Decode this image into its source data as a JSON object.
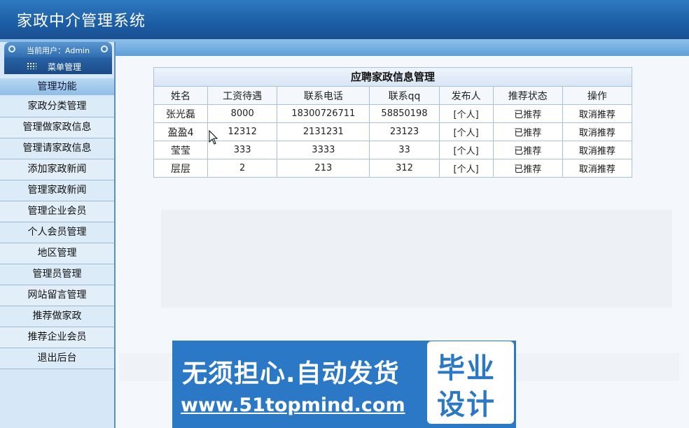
{
  "header": {
    "title": "家政中介管理系统"
  },
  "sidebar": {
    "current_user": "当前用户：Admin",
    "menu_button": "菜单管理",
    "section_title": "管理功能",
    "items": [
      {
        "label": "家政分类管理"
      },
      {
        "label": "管理做家政信息"
      },
      {
        "label": "管理请家政信息"
      },
      {
        "label": "添加家政新闻"
      },
      {
        "label": "管理家政新闻"
      },
      {
        "label": "管理企业会员"
      },
      {
        "label": "个人会员管理"
      },
      {
        "label": "地区管理"
      },
      {
        "label": "管理员管理"
      },
      {
        "label": "网站留言管理"
      },
      {
        "label": "推荐做家政"
      },
      {
        "label": "推荐企业会员"
      },
      {
        "label": "退出后台"
      }
    ]
  },
  "table": {
    "caption": "应聘家政信息管理",
    "columns": [
      "姓名",
      "工资待遇",
      "联系电话",
      "联系qq",
      "发布人",
      "推荐状态",
      "操作"
    ],
    "rows": [
      {
        "name": "张光磊",
        "salary": "8000",
        "phone": "18300726711",
        "qq": "58850198",
        "publisher": "[个人]",
        "status": "已推荐",
        "action": "取消推荐"
      },
      {
        "name": "盈盈4",
        "salary": "12312",
        "phone": "2131231",
        "qq": "23123",
        "publisher": "[个人]",
        "status": "已推荐",
        "action": "取消推荐"
      },
      {
        "name": "莹莹",
        "salary": "333",
        "phone": "3333",
        "qq": "33",
        "publisher": "[个人]",
        "status": "已推荐",
        "action": "取消推荐"
      },
      {
        "name": "层层",
        "salary": "2",
        "phone": "213",
        "qq": "312",
        "publisher": "[个人]",
        "status": "已推荐",
        "action": "取消推荐"
      }
    ]
  },
  "banner": {
    "slogan": "无须担心.自动发货",
    "url": "www.51topmind.com",
    "badge_line1": "毕业",
    "badge_line2": "设计"
  },
  "colors": {
    "header_blue": "#1c5ea6",
    "sidebar_bg": "#d6e8f7",
    "banner_blue": "#2b78c7"
  }
}
